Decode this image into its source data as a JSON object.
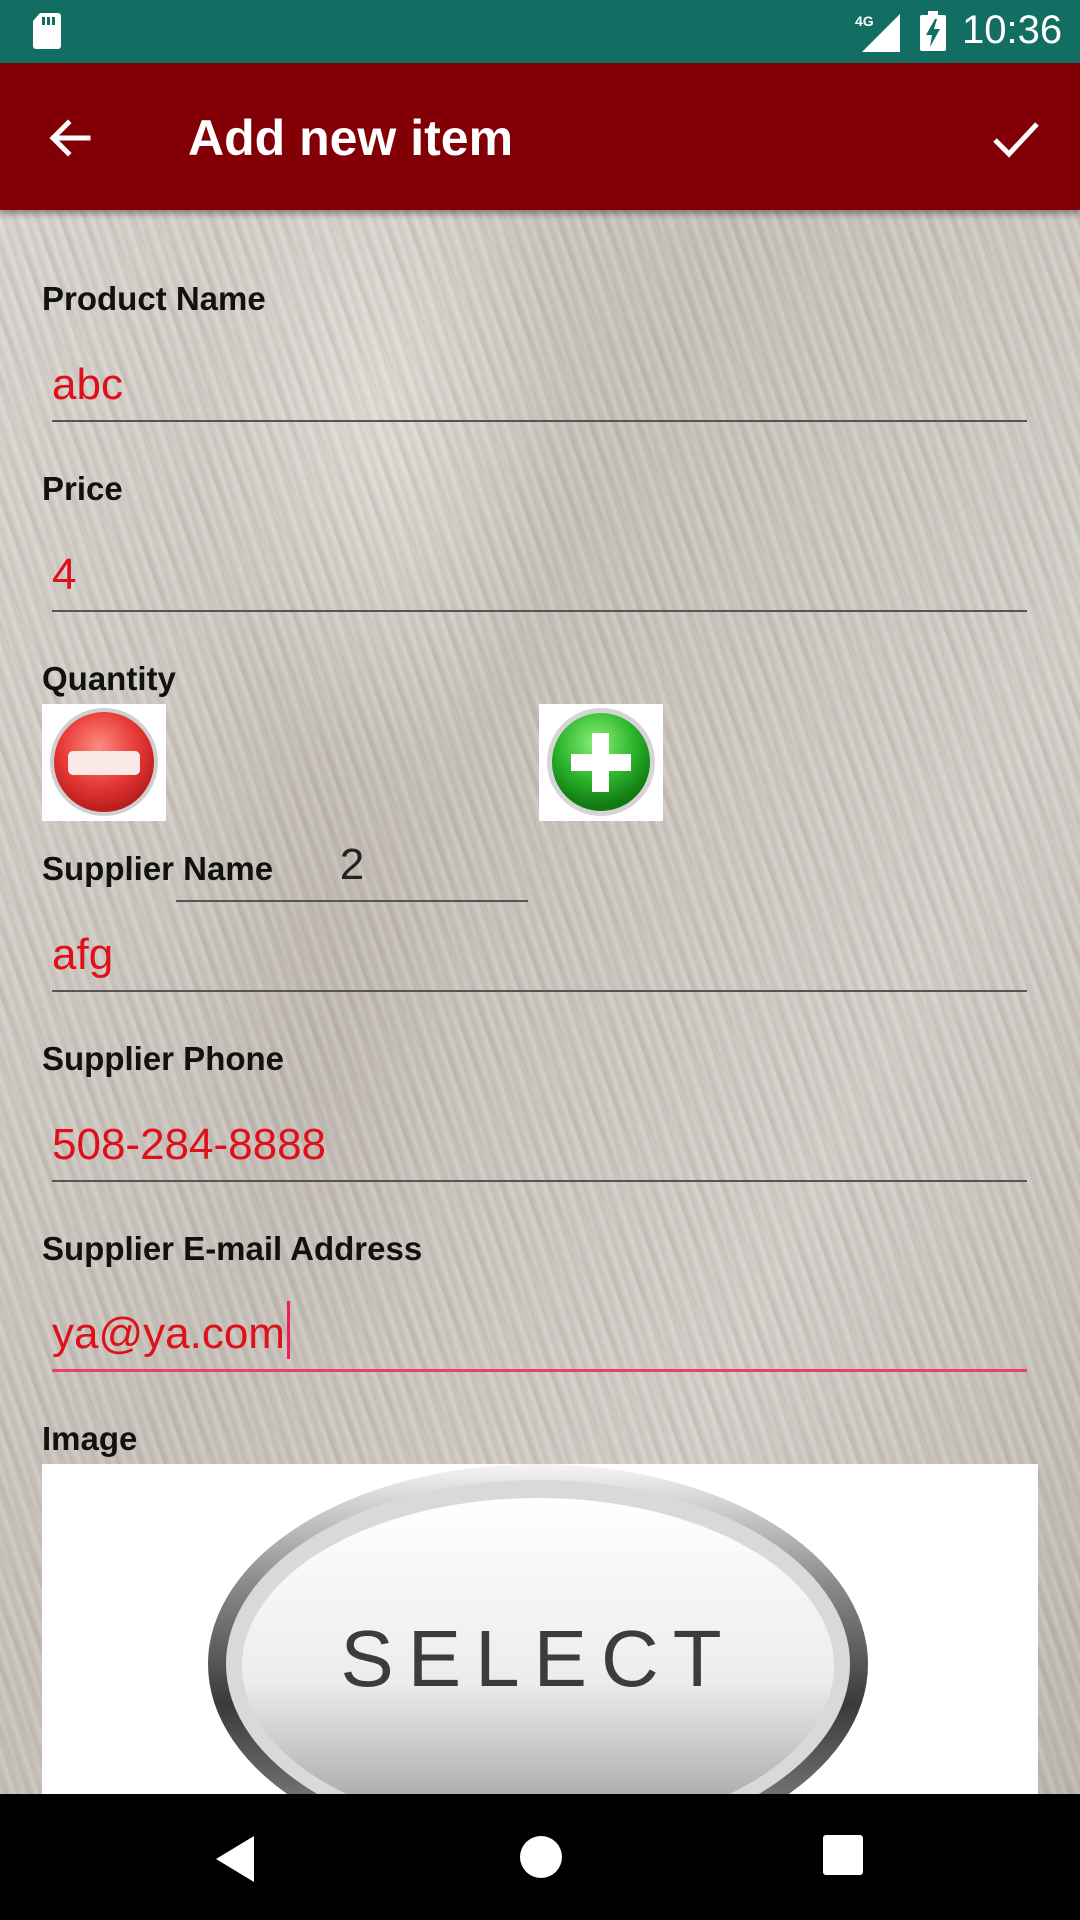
{
  "status_bar": {
    "time": "10:36",
    "network": "4G",
    "icons": [
      "sd-card-icon",
      "signal-icon",
      "battery-charging-icon"
    ]
  },
  "app_bar": {
    "title": "Add new item",
    "back_icon": "arrow-left-icon",
    "save_icon": "check-icon"
  },
  "form": {
    "product_name": {
      "label": "Product Name",
      "value": "abc"
    },
    "price": {
      "label": "Price",
      "value": "4"
    },
    "quantity": {
      "label": "Quantity",
      "value": "2",
      "decrease_icon": "minus-circle-icon",
      "increase_icon": "plus-circle-icon"
    },
    "supplier_name": {
      "label": "Supplier Name",
      "value": "afg"
    },
    "supplier_phone": {
      "label": "Supplier Phone",
      "value": "508-284-8888"
    },
    "supplier_email": {
      "label": "Supplier E-mail Address",
      "value": "ya@ya.com"
    },
    "image": {
      "label": "Image",
      "button_text": "SELECT"
    }
  },
  "colors": {
    "status_bar": "#126e62",
    "app_bar": "#820005",
    "value_text": "#e0101a",
    "focus_underline": "#ee3d6f"
  },
  "nav_bar": {
    "icons": [
      "nav-back-icon",
      "nav-home-icon",
      "nav-recents-icon"
    ]
  }
}
